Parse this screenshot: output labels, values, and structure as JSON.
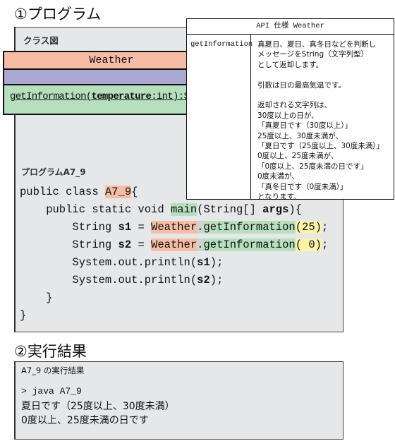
{
  "section1_title": "①プログラム",
  "class_diagram": {
    "label": "クラス図",
    "class_name": "Weather",
    "method_name": "getInformation(",
    "param_name": "temperature",
    "param_rest": ":int):String"
  },
  "api": {
    "header": "API 仕様 Weather",
    "method": "getInformation",
    "description": [
      "真夏日、夏日、真冬日などを判断し",
      "メッセージをString（文字列型）",
      "として返却します。",
      "",
      "引数は日の最高気温です。",
      "",
      "返却される文字列は、",
      "30度以上の日が、",
      "「真夏日です（30度以上）」",
      "25度以上、30度未満が、",
      "「夏日です（25度以上、30度未満）」",
      "0度以上、25度未満が、",
      "「0度以上、25度未満の日です」",
      "0度未満が、",
      "「真冬日です（0度未満）」",
      "となります。"
    ]
  },
  "program": {
    "label": "プログラムA7_9",
    "l1a": "public class ",
    "l1b": "A7_9",
    "l1c": "{",
    "l2a": "    public static void ",
    "l2b": "main",
    "l2c": "(String[] ",
    "l2d": "args",
    "l2e": "){",
    "l3a": "        String ",
    "l3b": "s1",
    "l3c": " = ",
    "l3d": "Weather",
    "l3e": ".",
    "l3f": "getInformation",
    "l3g": "(25)",
    "l3h": ";",
    "l4a": "        String ",
    "l4b": "s2",
    "l4c": " = ",
    "l4d": "Weather",
    "l4e": ".",
    "l4f": "getInformation",
    "l4g": "( 0)",
    "l4h": ";",
    "l5a": "        System.out.println(",
    "l5b": "s1",
    "l5c": ");",
    "l6a": "        System.out.println(",
    "l6b": "s2",
    "l6c": ");",
    "l7": "    }",
    "l8": "}"
  },
  "section2_title": "②実行結果",
  "result": {
    "label": "A7_9 の実行結果",
    "command": "> java A7_9",
    "output": [
      "夏日です（25度以上、30度未満）",
      "0度以上、25度未満の日です"
    ]
  },
  "colors": {
    "class_header": "#f7bca5",
    "attributes": "#aba8d4",
    "methods": "#b6dfbe",
    "arg_highlight": "#fdf3a6",
    "panel": "#e6e7e9"
  }
}
